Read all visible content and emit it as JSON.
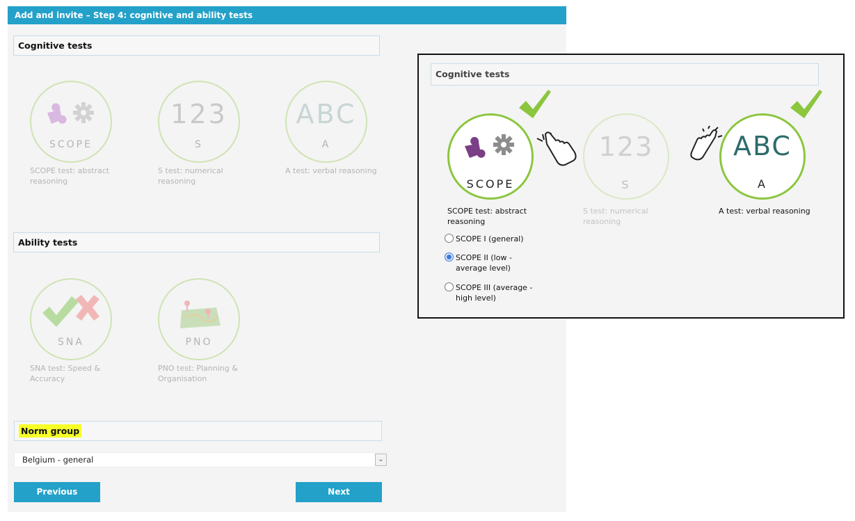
{
  "window": {
    "title": "Add and invite – Step 4: cognitive and ability tests"
  },
  "cognitive": {
    "heading": "Cognitive tests",
    "tiles": [
      {
        "code": "SCOPE",
        "caption": "SCOPE test: abstract reasoning",
        "icon": "puzzle-gear-icon"
      },
      {
        "code": "S",
        "big": "123",
        "caption": "S test: numerical reasoning"
      },
      {
        "code": "A",
        "big": "ABC",
        "caption": "A test: verbal reasoning"
      }
    ]
  },
  "ability": {
    "heading": "Ability tests",
    "tiles": [
      {
        "code": "SNA",
        "caption": "SNA test: Speed & Accuracy",
        "icon": "check-cross-icon"
      },
      {
        "code": "PNO",
        "caption": "PNO test: Planning & Organisation",
        "icon": "map-icon"
      }
    ]
  },
  "norm": {
    "heading": "Norm group",
    "selected": "Belgium - general"
  },
  "buttons": {
    "previous": "Previous",
    "next": "Next"
  },
  "inset": {
    "heading": "Cognitive tests",
    "tiles": [
      {
        "code": "SCOPE",
        "caption": "SCOPE test: abstract reasoning",
        "selected": true
      },
      {
        "code": "S",
        "big": "123",
        "caption": "S test: numerical reasoning",
        "selected": false
      },
      {
        "code": "A",
        "big": "ABC",
        "caption": "A test: verbal reasoning",
        "selected": true
      }
    ],
    "options": [
      {
        "label": "SCOPE I (general)",
        "checked": false
      },
      {
        "label": "SCOPE II (low - average level)",
        "checked": true
      },
      {
        "label": "SCOPE III (average - high level)",
        "checked": false
      }
    ]
  },
  "colors": {
    "accent": "#23a1c9",
    "check": "#8cc63f",
    "highlight": "#f6ff27",
    "abc": "#2e6b6b"
  }
}
